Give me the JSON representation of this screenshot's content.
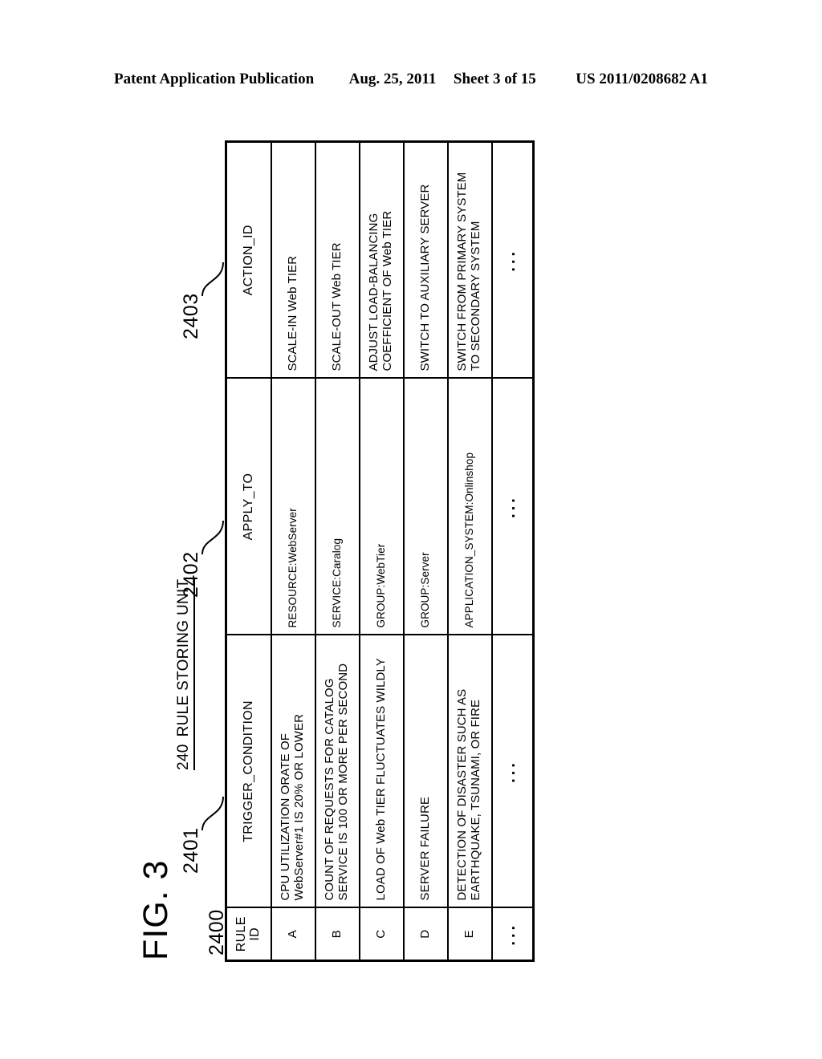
{
  "header": {
    "publication": "Patent Application Publication",
    "date": "Aug. 25, 2011",
    "sheet": "Sheet 3 of 15",
    "docnum": "US 2011/0208682 A1"
  },
  "figure": {
    "label": "FIG. 3",
    "unit_number": "240",
    "unit_name": "RULE STORING UNIT",
    "ellipsis": "..."
  },
  "refs": {
    "rule_id": "2400",
    "trigger_condition": "2401",
    "apply_to": "2402",
    "action_id": "2403"
  },
  "table": {
    "columns": [
      {
        "id": "rule_id",
        "header_line1": "RULE",
        "header_line2": "ID"
      },
      {
        "id": "trigger_condition",
        "header_line1": "TRIGGER_CONDITION",
        "header_line2": ""
      },
      {
        "id": "apply_to",
        "header_line1": "APPLY_TO",
        "header_line2": ""
      },
      {
        "id": "action_id",
        "header_line1": "ACTION_ID",
        "header_line2": ""
      }
    ],
    "rows": [
      {
        "rule_id": "A",
        "trigger_line1": "CPU UTILIZATION ORATE OF",
        "trigger_line2": "WebServer#1 IS 20% OR LOWER",
        "apply_to": "RESOURCE:WebServer",
        "action_line1": "SCALE-IN Web TIER",
        "action_line2": ""
      },
      {
        "rule_id": "B",
        "trigger_line1": "COUNT OF REQUESTS FOR CATALOG",
        "trigger_line2": "SERVICE IS 100 OR MORE PER SECOND",
        "apply_to": "SERVICE:Caralog",
        "action_line1": "SCALE-OUT Web TIER",
        "action_line2": ""
      },
      {
        "rule_id": "C",
        "trigger_line1": "LOAD OF Web TIER FLUCTUATES WILDLY",
        "trigger_line2": "",
        "apply_to": "GROUP:WebTier",
        "action_line1": "ADJUST LOAD-BALANCING",
        "action_line2": "COEFFICIENT OF Web TIER"
      },
      {
        "rule_id": "D",
        "trigger_line1": "SERVER FAILURE",
        "trigger_line2": "",
        "apply_to": "GROUP:Server",
        "action_line1": "SWITCH TO AUXILIARY SERVER",
        "action_line2": ""
      },
      {
        "rule_id": "E",
        "trigger_line1": "DETECTION OF DISASTER SUCH AS",
        "trigger_line2": "EARTHQUAKE, TSUNAMI, OR FIRE",
        "apply_to": "APPLICATION_SYSTEM:Onlinshop",
        "action_line1": "SWITCH FROM PRIMARY SYSTEM",
        "action_line2": "TO SECONDARY SYSTEM"
      },
      {
        "rule_id": "...",
        "trigger_line1": "...",
        "trigger_line2": "",
        "apply_to": "...",
        "action_line1": "...",
        "action_line2": ""
      }
    ]
  }
}
